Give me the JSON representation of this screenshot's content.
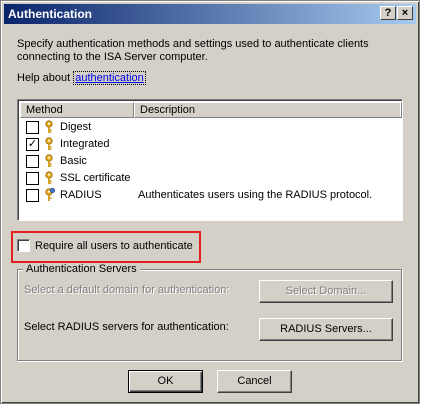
{
  "window": {
    "title": "Authentication",
    "help_button": "?",
    "close_button": "×"
  },
  "intro_text": "Specify authentication methods and settings used to authenticate clients connecting to the ISA Server computer.",
  "help": {
    "prefix": "Help about ",
    "link": "authentication"
  },
  "methods_list": {
    "columns": [
      "Method",
      "Description"
    ],
    "rows": [
      {
        "name": "Digest",
        "description": "",
        "checked": false,
        "icon": "key-icon"
      },
      {
        "name": "Integrated",
        "description": "",
        "checked": true,
        "icon": "key-icon"
      },
      {
        "name": "Basic",
        "description": "",
        "checked": false,
        "icon": "key-icon"
      },
      {
        "name": "SSL certificate",
        "description": "",
        "checked": false,
        "icon": "key-icon"
      },
      {
        "name": "RADIUS",
        "description": "Authenticates users using the RADIUS protocol.",
        "checked": false,
        "icon": "key-network-icon"
      }
    ]
  },
  "require_all": {
    "label": "Require all users to authenticate",
    "checked": false,
    "highlight_color": "#e02020"
  },
  "auth_servers": {
    "title": "Authentication Servers",
    "domain_text": "Select a default domain for authentication:",
    "domain_button": "Select Domain...",
    "domain_enabled": false,
    "radius_text": "Select RADIUS servers for authentication:",
    "radius_button": "RADIUS Servers...",
    "radius_enabled": true
  },
  "footer": {
    "ok": "OK",
    "cancel": "Cancel"
  },
  "colors": {
    "face": "#d4d0c8",
    "title_start": "#0a246a",
    "title_end": "#a6caf0",
    "link": "#0000ee"
  }
}
